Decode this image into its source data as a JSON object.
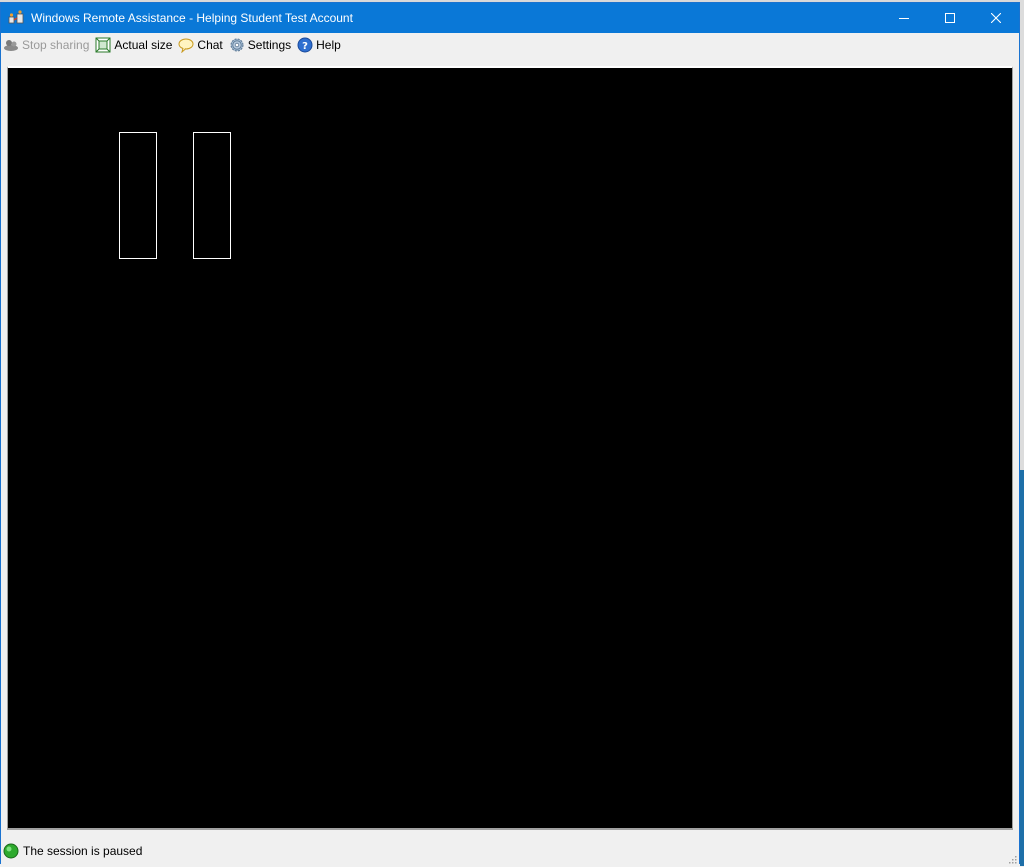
{
  "window": {
    "title": "Windows Remote Assistance - Helping Student Test Account"
  },
  "toolbar": {
    "items": [
      {
        "label": "Stop sharing",
        "icon": "stop-sharing-icon",
        "enabled": false
      },
      {
        "label": "Actual size",
        "icon": "actual-size-icon",
        "enabled": true
      },
      {
        "label": "Chat",
        "icon": "chat-icon",
        "enabled": true
      },
      {
        "label": "Settings",
        "icon": "gear-icon",
        "enabled": true
      },
      {
        "label": "Help",
        "icon": "help-icon",
        "enabled": true
      }
    ]
  },
  "viewer": {
    "state_icon": "pause-icon"
  },
  "status": {
    "text": "The session is paused",
    "icon": "green-status-icon"
  },
  "colors": {
    "titlebar": "#0a78d7",
    "viewer_bg": "#000000",
    "status_green": "#2eaa2e"
  }
}
